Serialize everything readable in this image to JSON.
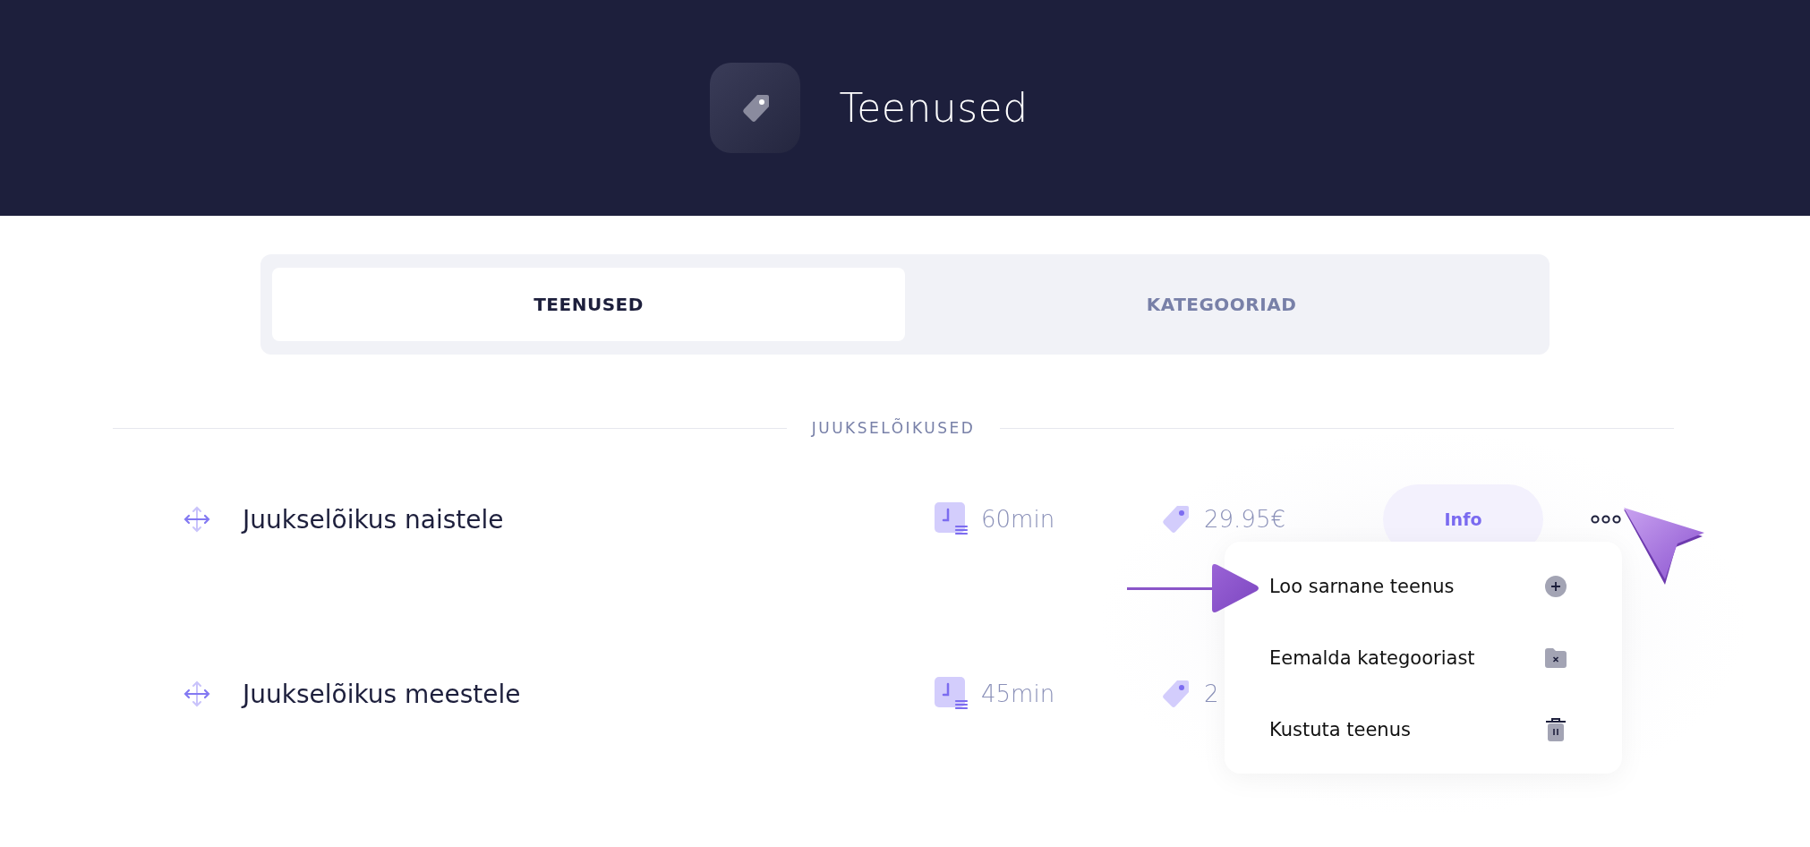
{
  "header": {
    "title": "Teenused"
  },
  "tabs": [
    {
      "label": "TEENUSED",
      "selected": true
    },
    {
      "label": "KATEGOORIAD",
      "selected": false
    }
  ],
  "section": {
    "title": "JUUKSELÕIKUSED"
  },
  "services": [
    {
      "name": "Juukselõikus naistele",
      "duration": "60min",
      "price": "29.95€",
      "info": "Info"
    },
    {
      "name": "Juukselõikus meestele",
      "duration": "45min",
      "price": "2"
    }
  ],
  "menu": {
    "items": [
      {
        "kind": "copy",
        "label": "Loo sarnane teenus"
      },
      {
        "kind": "remove",
        "label": "Eemalda kategooriast"
      },
      {
        "kind": "delete",
        "label": "Kustuta teenus"
      }
    ]
  }
}
